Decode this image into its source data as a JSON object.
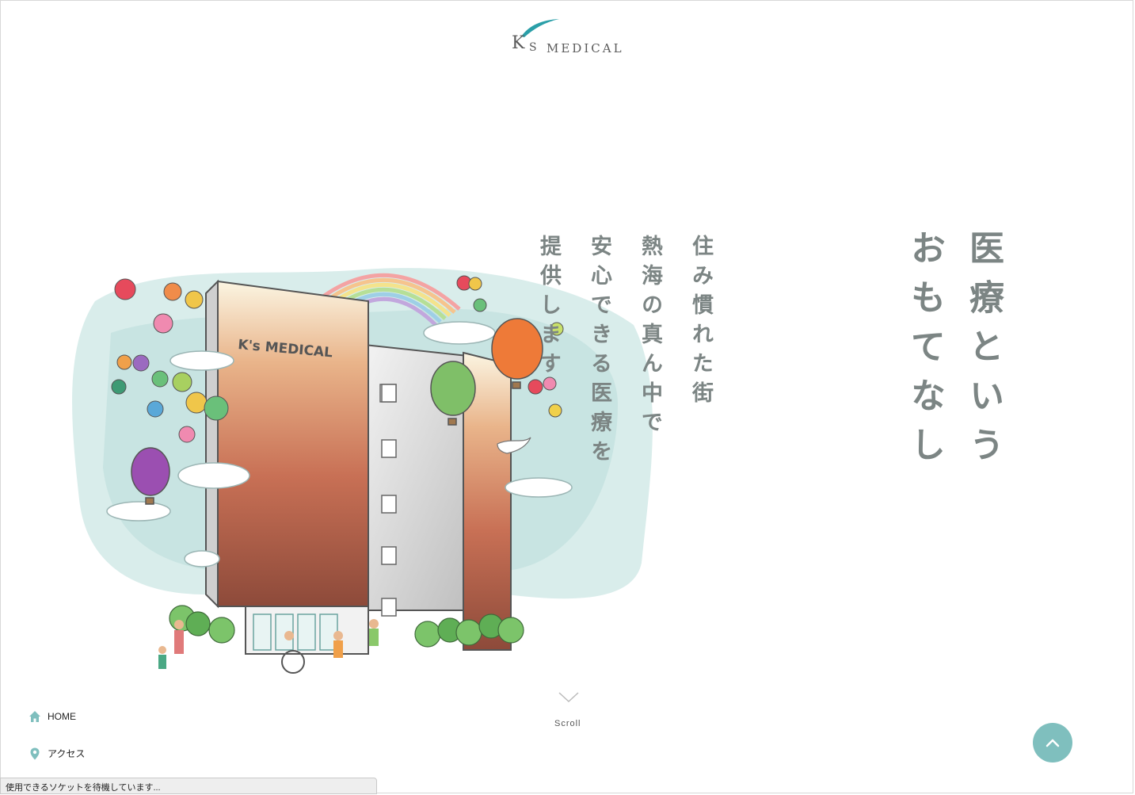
{
  "logo": {
    "k": "K",
    "s": "S",
    "medical": "MEDICAL"
  },
  "illustration": {
    "sign_text": "K's MEDICAL"
  },
  "catch_main": [
    "医療という",
    "おもてなし"
  ],
  "catch_sub": [
    "住み慣れた街",
    "熱海の真ん中で",
    "安心できる医療を",
    "提供します"
  ],
  "scroll": {
    "label": "Scroll"
  },
  "nav": {
    "home": {
      "label": "HOME",
      "icon": "home-icon"
    },
    "access": {
      "label": "アクセス",
      "icon": "map-pin-icon"
    }
  },
  "status_bar": {
    "text": "使用できるソケットを待機しています..."
  },
  "colors": {
    "accent": "#7fbfbe",
    "text_gray": "#7c8584",
    "logo_swoosh": "#2a9fa8"
  }
}
